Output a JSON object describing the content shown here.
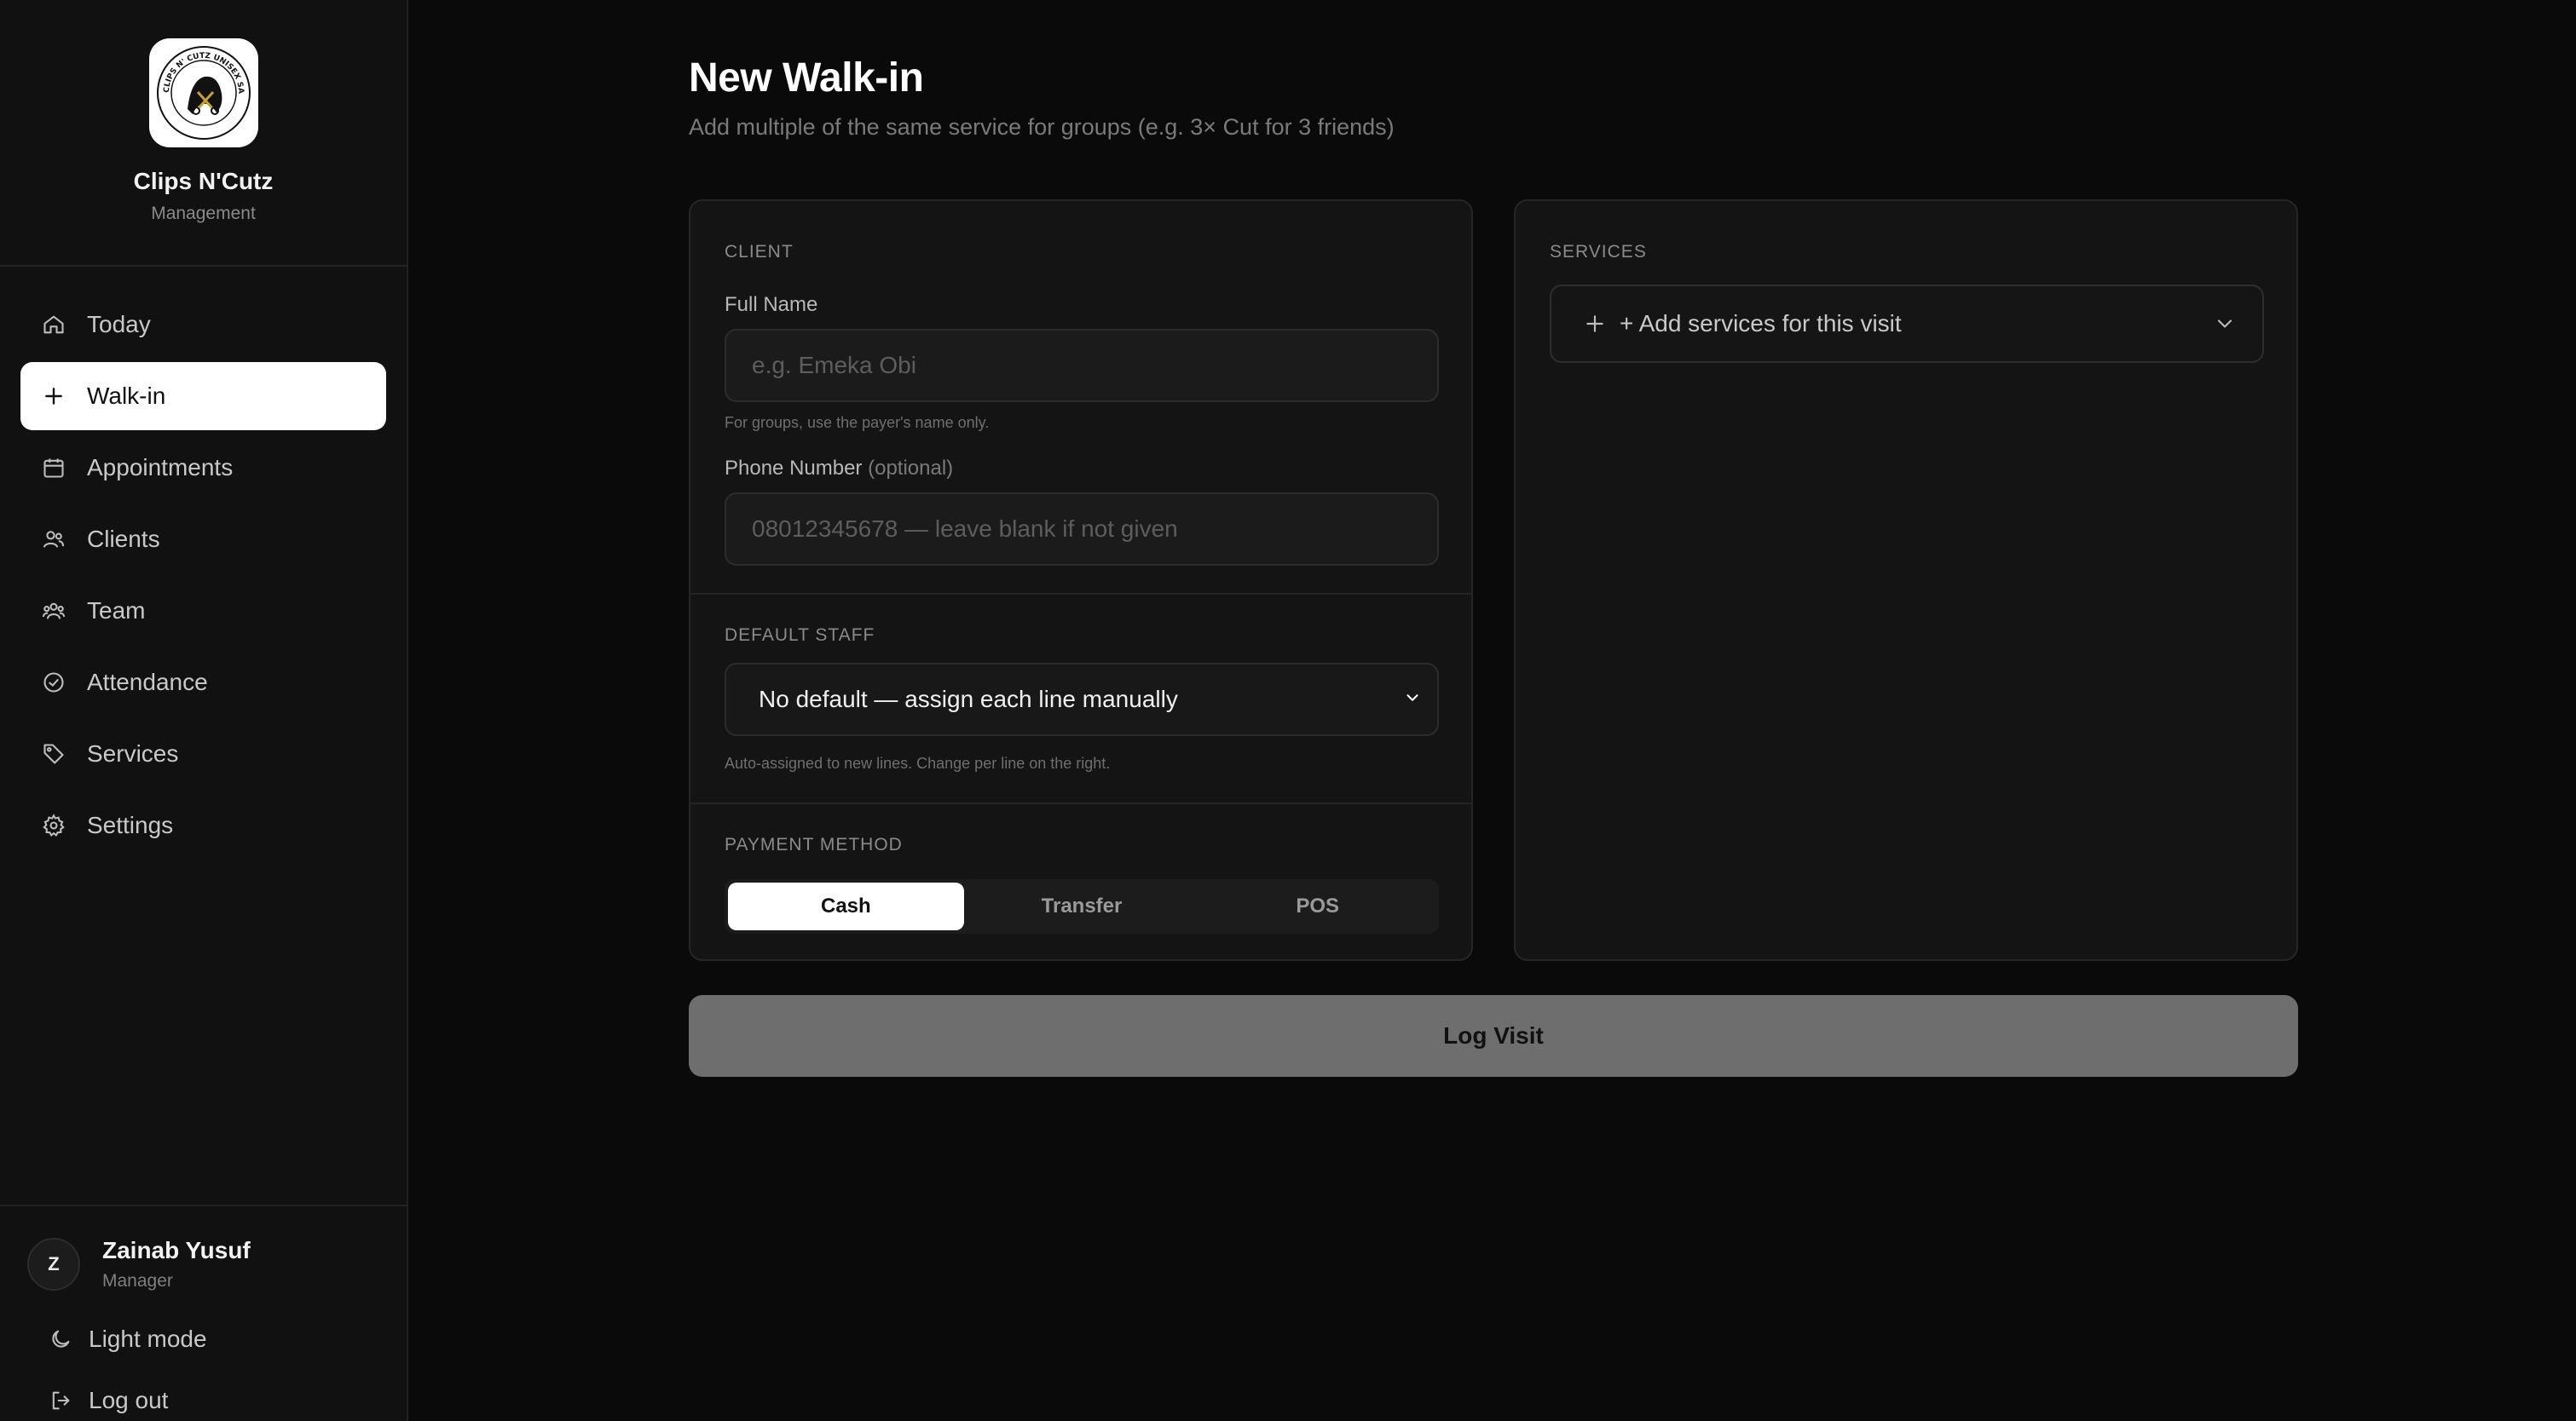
{
  "brand": {
    "name": "Clips N'Cutz",
    "subtitle": "Management",
    "logo_text": "CLIPS N' CUTZ UNISEX SALON"
  },
  "nav": {
    "items": [
      {
        "label": "Today",
        "icon": "home-icon",
        "active": false
      },
      {
        "label": "Walk-in",
        "icon": "plus-icon",
        "active": true
      },
      {
        "label": "Appointments",
        "icon": "calendar-icon",
        "active": false
      },
      {
        "label": "Clients",
        "icon": "users-icon",
        "active": false
      },
      {
        "label": "Team",
        "icon": "team-icon",
        "active": false
      },
      {
        "label": "Attendance",
        "icon": "check-circle-icon",
        "active": false
      },
      {
        "label": "Services",
        "icon": "tag-icon",
        "active": false
      },
      {
        "label": "Settings",
        "icon": "gear-icon",
        "active": false
      }
    ]
  },
  "user": {
    "initial": "Z",
    "name": "Zainab Yusuf",
    "role": "Manager"
  },
  "bottom": {
    "light_mode": "Light mode",
    "logout": "Log out"
  },
  "page": {
    "title": "New Walk-in",
    "subtitle": "Add multiple of the same service for groups (e.g. 3× Cut for 3 friends)"
  },
  "client": {
    "section": "CLIENT",
    "full_name_label": "Full Name",
    "full_name_placeholder": "e.g. Emeka Obi",
    "full_name_value": "",
    "full_name_hint": "For groups, use the payer's name only.",
    "phone_label": "Phone Number",
    "phone_optional": "(optional)",
    "phone_placeholder": "08012345678 — leave blank if not given",
    "phone_value": ""
  },
  "staff": {
    "section": "DEFAULT STAFF",
    "selected": "No default — assign each line manually",
    "hint": "Auto-assigned to new lines. Change per line on the right."
  },
  "payment": {
    "section": "PAYMENT METHOD",
    "options": [
      "Cash",
      "Transfer",
      "POS"
    ],
    "selected": "Cash"
  },
  "services": {
    "section": "SERVICES",
    "add_label": "+ Add services for this visit"
  },
  "submit": {
    "label": "Log Visit"
  },
  "colors": {
    "background": "#0a0a0a",
    "sidebar": "#111111",
    "card": "#141414",
    "active": "#ffffff",
    "submit_disabled": "#6e6e6e"
  }
}
